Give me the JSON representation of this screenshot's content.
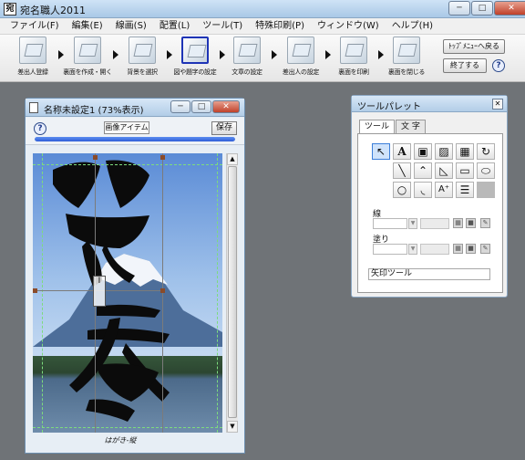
{
  "app": {
    "title": "宛名職人2011",
    "icon_label": "宛"
  },
  "window_controls": {
    "minimize": "─",
    "maximize": "□",
    "close": "✕"
  },
  "menu": [
    "ファイル(F)",
    "編集(E)",
    "線画(S)",
    "配置(L)",
    "ツール(T)",
    "特殊印刷(P)",
    "ウィンドウ(W)",
    "ヘルプ(H)"
  ],
  "toolbar": {
    "steps": [
      "差出人登録",
      "裏面を作成・開く",
      "背景を選択",
      "図や題字の設定",
      "文章の設定",
      "差出人の設定",
      "裏面を印刷",
      "裏面を閉じる"
    ],
    "active_step": 3,
    "top_menu_button": "ﾄｯﾌﾟﾒﾆｭｰへ戻る",
    "exit_button": "終了する",
    "help": "?"
  },
  "document": {
    "title": "名称未設定1 (73%表示)",
    "help": "?",
    "image_item_button": "画像アイテム",
    "save_button": "保存",
    "progress": 1.0,
    "paper_label": "はがき-縦",
    "scroll_up": "▲",
    "scroll_down": "▼",
    "cursor_glyph": "I"
  },
  "palette": {
    "title": "ツールパレット",
    "close": "✕",
    "tabs": [
      "ツール",
      "文 字"
    ],
    "active_tab": 0,
    "tools": [
      {
        "name": "arrow-tool-icon",
        "glyph": "↖"
      },
      {
        "name": "text-tool-icon",
        "glyph": "A"
      },
      {
        "name": "image-tool-icon",
        "glyph": "▣"
      },
      {
        "name": "pattern-tool-icon",
        "glyph": "▨"
      },
      {
        "name": "qr-tool-icon",
        "glyph": "▦"
      },
      {
        "name": "rotate-tool-icon",
        "glyph": "↻"
      },
      {
        "name": "line-tool-icon",
        "glyph": "╲"
      },
      {
        "name": "polyline-tool-icon",
        "glyph": "⌃"
      },
      {
        "name": "polygon-tool-icon",
        "glyph": "◺"
      },
      {
        "name": "rectangle-tool-icon",
        "glyph": "▭"
      },
      {
        "name": "oval-tool-icon",
        "glyph": "⬭"
      },
      {
        "name": "circle-tool-icon",
        "glyph": "○"
      },
      {
        "name": "arc-tool-icon",
        "glyph": "◟"
      },
      {
        "name": "add-text-tool-icon",
        "glyph": "A⁺"
      },
      {
        "name": "list-tool-icon",
        "glyph": "☰"
      }
    ],
    "line_label": "線",
    "fill_label": "塗り",
    "status_text": "矢印ツール"
  },
  "colors": {
    "desktop": "#6f7377",
    "titlebar": "#b2cde7",
    "accent_blue": "#2f5ed8",
    "selection_guides": "#7ddc7d"
  }
}
